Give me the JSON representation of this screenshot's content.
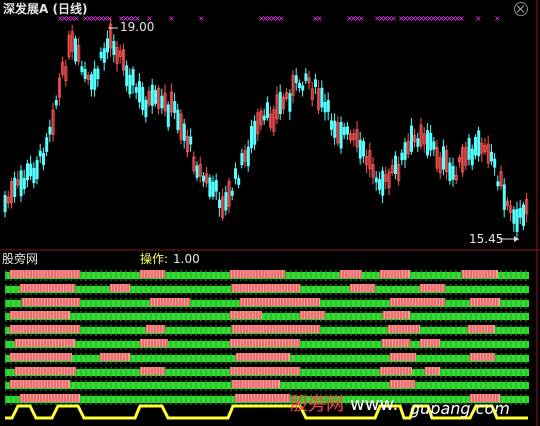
{
  "header": {
    "title": "深发展A (日线)",
    "close_icon": "close-icon"
  },
  "price_panel": {
    "high_label": "19.00",
    "low_label": "15.45"
  },
  "indicator_panel": {
    "title": "股旁网",
    "op_label": "操作:",
    "op_value": "1.00"
  },
  "watermark": {
    "part1": "股旁网",
    "part2": "www.",
    "part3": "gupang.com"
  },
  "colors": {
    "up": "#ff5555",
    "down": "#55ffff",
    "marker": "#ff33ff",
    "green": "#33dd33",
    "pink": "#ff9999",
    "yellow": "#ffff33"
  }
}
